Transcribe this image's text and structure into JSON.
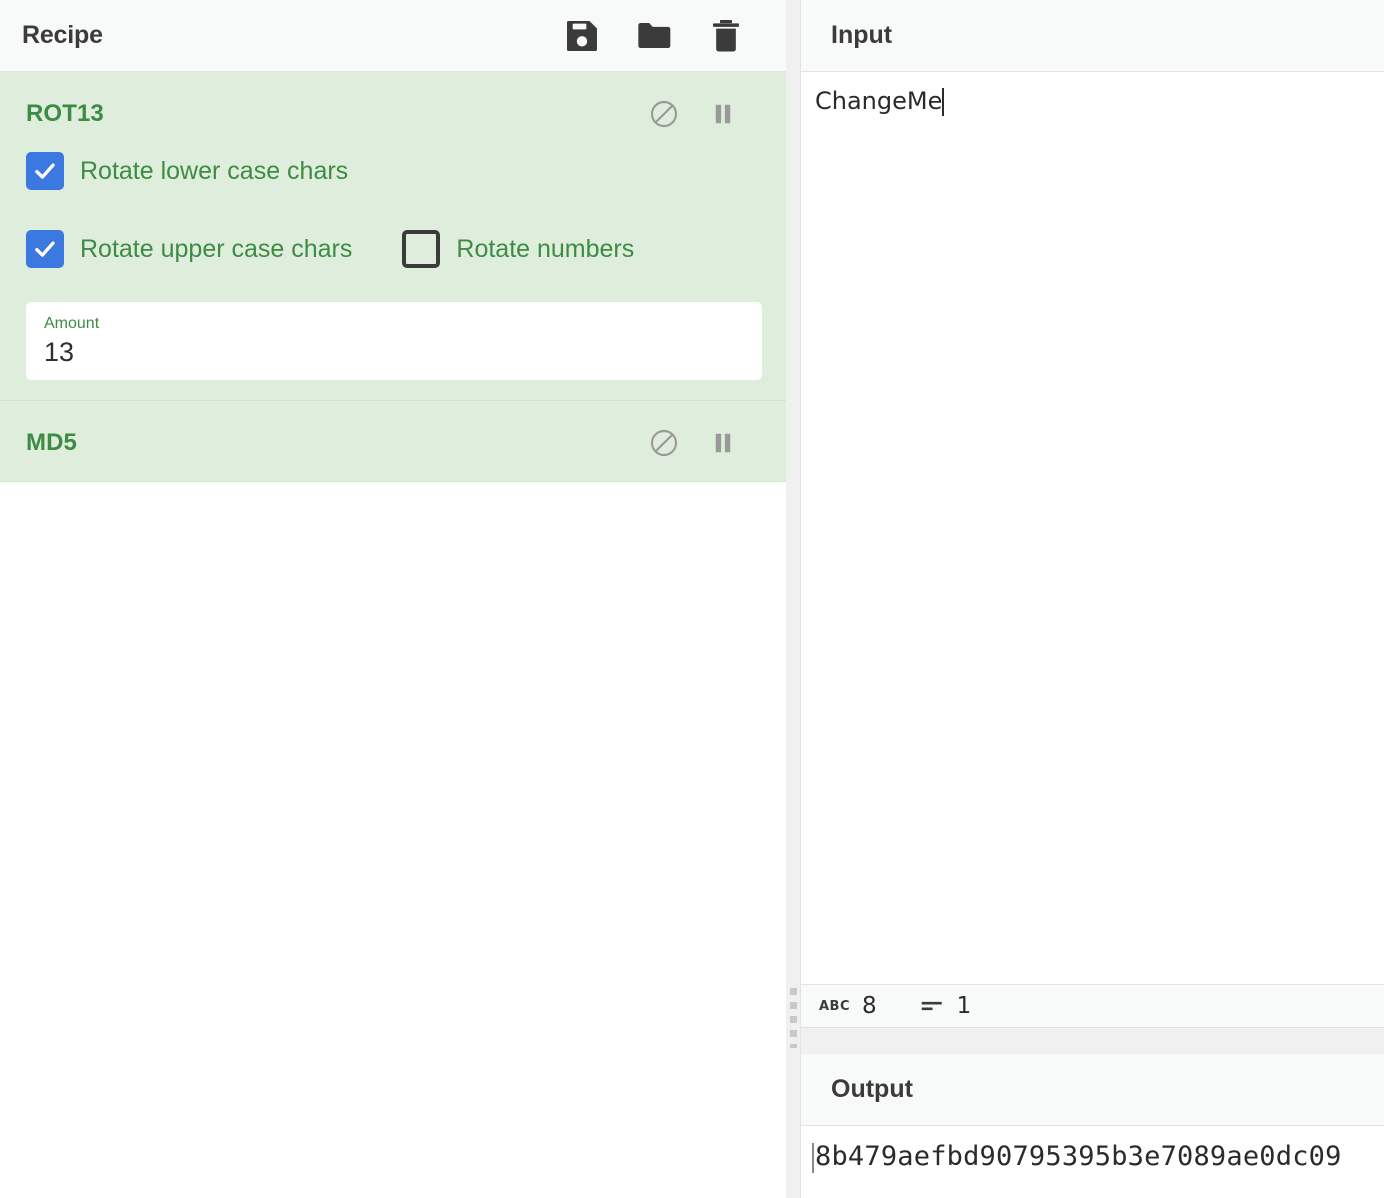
{
  "recipe": {
    "title": "Recipe",
    "toolbar": [
      {
        "name": "save-recipe-icon",
        "label": "save"
      },
      {
        "name": "load-recipe-icon",
        "label": "folder"
      },
      {
        "name": "clear-recipe-icon",
        "label": "trash"
      }
    ],
    "operations": [
      {
        "name": "ROT13",
        "disable_icon": "disable-icon",
        "breakpoint_icon": "pause-icon",
        "args": {
          "rotate_lower": {
            "label": "Rotate lower case chars",
            "checked": true
          },
          "rotate_upper": {
            "label": "Rotate upper case chars",
            "checked": true
          },
          "rotate_numbers": {
            "label": "Rotate numbers",
            "checked": false
          },
          "amount": {
            "label": "Amount",
            "value": "13"
          }
        }
      },
      {
        "name": "MD5",
        "disable_icon": "disable-icon",
        "breakpoint_icon": "pause-icon",
        "args": {}
      }
    ]
  },
  "input": {
    "title": "Input",
    "value": "ChangeMe",
    "status": {
      "length_icon": "ABC",
      "length": "8",
      "lines_icon": "lines-icon",
      "lines": "1"
    }
  },
  "output": {
    "title": "Output",
    "value": "8b479aefbd90795395b3e7089ae0dc09"
  },
  "colors": {
    "operation_bg": "#dfeedc",
    "operation_title": "#3d8b44",
    "checkbox_checked": "#3b78e0",
    "header_bg": "#f8f9f9"
  }
}
